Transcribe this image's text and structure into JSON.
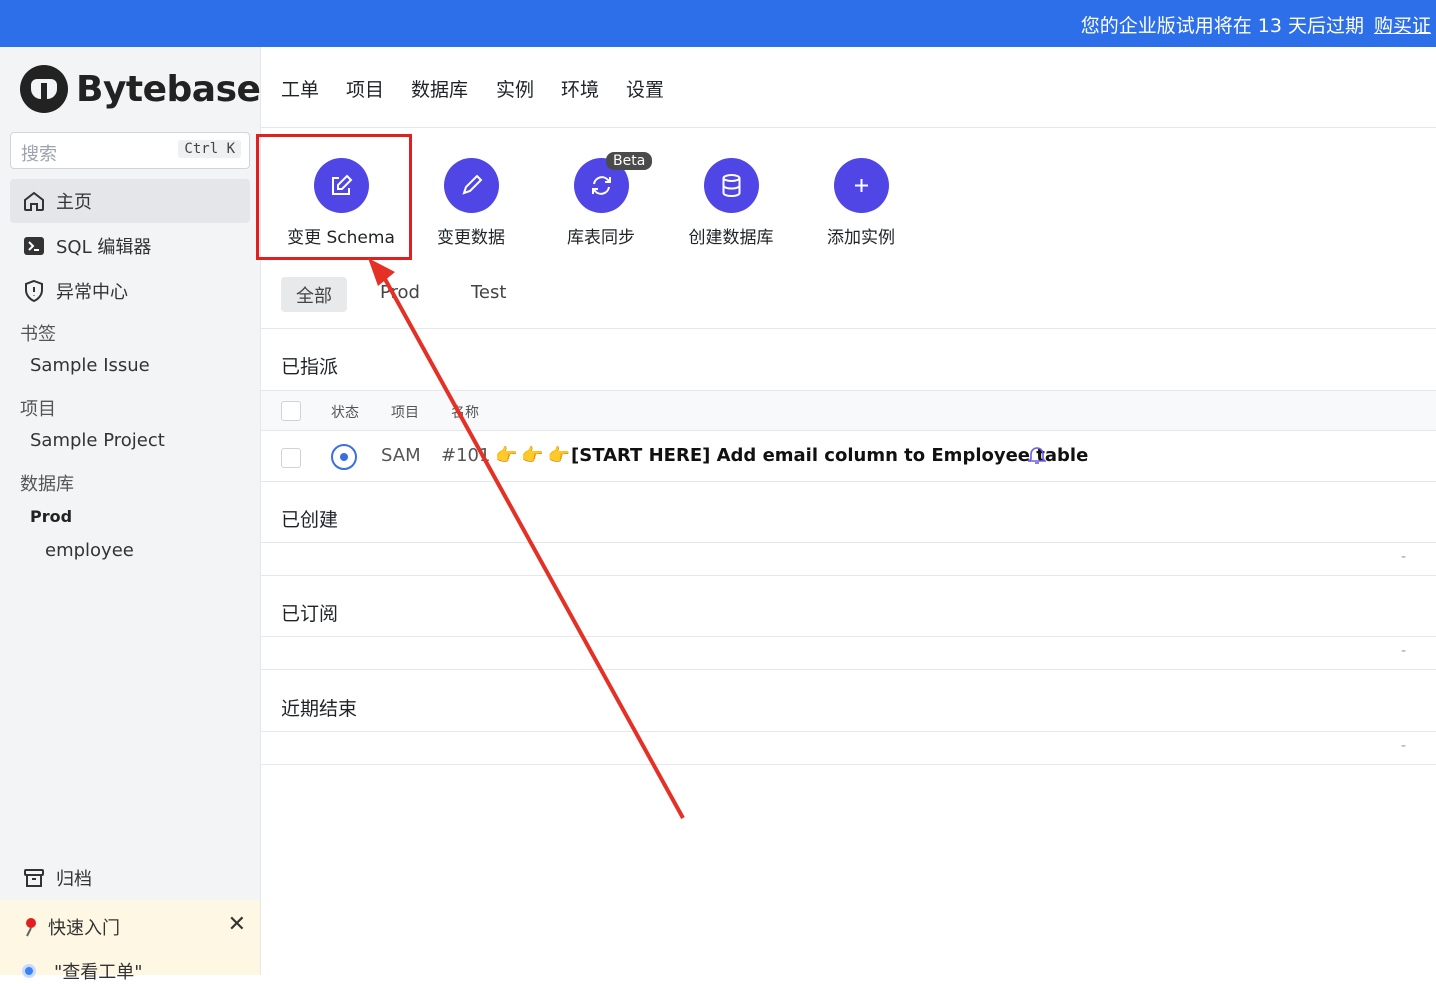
{
  "banner": {
    "message": "您的企业版试用将在 13 天后过期",
    "buy_link": "购买证"
  },
  "sidebar": {
    "brand": "Bytebase",
    "search": {
      "placeholder": "搜索",
      "shortcut": "Ctrl K"
    },
    "nav": [
      {
        "label": "主页",
        "icon": "home-icon"
      },
      {
        "label": "SQL 编辑器",
        "icon": "terminal-icon"
      },
      {
        "label": "异常中心",
        "icon": "shield-icon"
      }
    ],
    "bookmarks_label": "书签",
    "bookmark_item": "Sample Issue",
    "projects_label": "项目",
    "project_item": "Sample Project",
    "databases_label": "数据库",
    "env_label": "Prod",
    "database_item": "employee",
    "archive": "归档",
    "quickstart": {
      "title": "快速入门",
      "step": "\"查看工单\""
    }
  },
  "topnav": [
    "工单",
    "项目",
    "数据库",
    "实例",
    "环境",
    "设置"
  ],
  "actions": [
    {
      "label": "变更 Schema",
      "icon": "edit-icon"
    },
    {
      "label": "变更数据",
      "icon": "pencil-icon"
    },
    {
      "label": "库表同步",
      "icon": "sync-icon",
      "badge": "Beta"
    },
    {
      "label": "创建数据库",
      "icon": "database-icon"
    },
    {
      "label": "添加实例",
      "icon": "plus-icon"
    }
  ],
  "filters": [
    "全部",
    "Prod",
    "Test"
  ],
  "sections": {
    "assigned": "已指派",
    "created": "已创建",
    "subscribed": "已订阅",
    "recently_closed": "近期结束"
  },
  "table": {
    "headers": [
      "状态",
      "项目",
      "名称"
    ],
    "row": {
      "project": "SAM",
      "number": "#101",
      "emoji": "👉👉👉",
      "title": "[START HERE] Add email column to Employee table"
    },
    "empty_marker": "-"
  },
  "colors": {
    "accent": "#4f46e5",
    "banner": "#2d6ee9",
    "highlight": "#e02020"
  }
}
